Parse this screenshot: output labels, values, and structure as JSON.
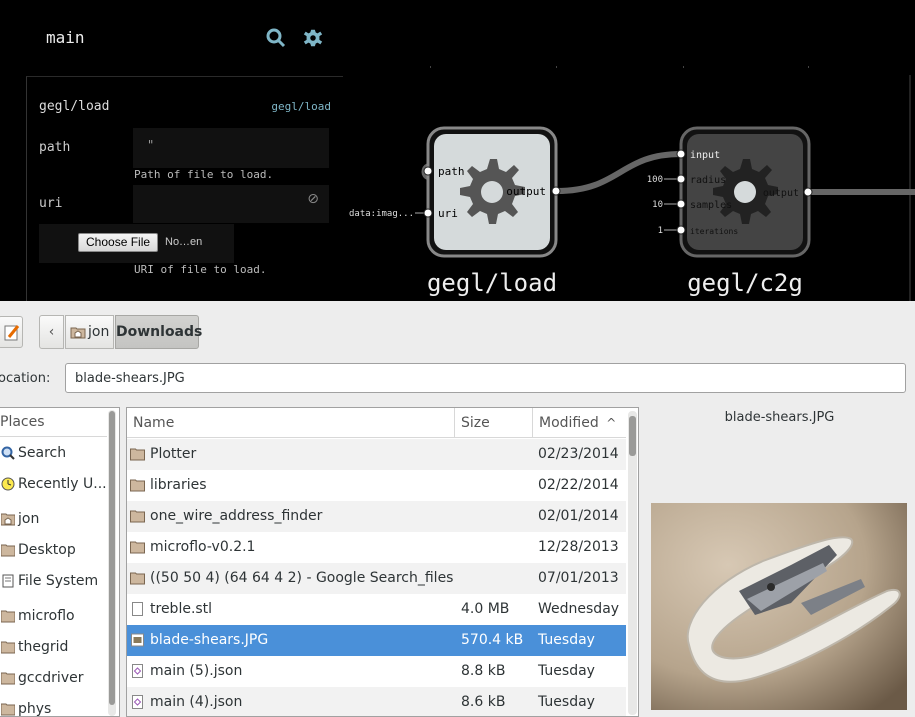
{
  "editor": {
    "graph_title": "main",
    "panel": {
      "title": "gegl/load",
      "link": "gegl/load",
      "path_label": "path",
      "path_value": "\"",
      "path_desc": "Path of file to load.",
      "uri_label": "uri",
      "uri_clear_icon": "⊘",
      "choose_file": "Choose File",
      "file_name": "No…en",
      "uri_desc": "URI of file to load."
    },
    "nodes": [
      {
        "title": "gegl/load",
        "inports": [
          "path",
          "uri"
        ],
        "outports": [
          "output"
        ],
        "inport_values": [
          "",
          "data:imag..."
        ]
      },
      {
        "title": "gegl/c2g",
        "inports": [
          "input",
          "radius",
          "samples",
          "iterations"
        ],
        "outports": [
          "output"
        ],
        "inport_values": [
          "",
          "100",
          "10",
          "1"
        ]
      }
    ],
    "accent_color": "#7fb6c7"
  },
  "chooser": {
    "breadcrumbs": [
      "jon",
      "Downloads"
    ],
    "location_label": "ocation:",
    "location_value": "blade-shears.JPG",
    "places_header": "Places",
    "places": [
      {
        "label": "Search",
        "icon": "search-icon"
      },
      {
        "label": "Recently U...",
        "icon": "recent-icon"
      },
      {
        "label": "jon",
        "icon": "home-folder-icon"
      },
      {
        "label": "Desktop",
        "icon": "folder-icon"
      },
      {
        "label": "File System",
        "icon": "drive-icon"
      },
      {
        "label": "microflo",
        "icon": "folder-icon"
      },
      {
        "label": "thegrid",
        "icon": "folder-icon"
      },
      {
        "label": "gccdriver",
        "icon": "folder-icon"
      },
      {
        "label": "phys",
        "icon": "folder-icon"
      }
    ],
    "columns": {
      "name": "Name",
      "size": "Size",
      "modified": "Modified"
    },
    "files": [
      {
        "name": "Plotter",
        "size": "",
        "modified": "02/23/2014",
        "icon": "folder-icon"
      },
      {
        "name": "libraries",
        "size": "",
        "modified": "02/22/2014",
        "icon": "folder-icon"
      },
      {
        "name": "one_wire_address_finder",
        "size": "",
        "modified": "02/01/2014",
        "icon": "folder-icon"
      },
      {
        "name": "microflo-v0.2.1",
        "size": "",
        "modified": "12/28/2013",
        "icon": "folder-icon"
      },
      {
        "name": "((50 50 4) (64 64 4 2) - Google Search_files",
        "size": "",
        "modified": "07/01/2013",
        "icon": "folder-icon"
      },
      {
        "name": "treble.stl",
        "size": "4.0 MB",
        "modified": "Wednesday",
        "icon": "file-icon"
      },
      {
        "name": "blade-shears.JPG",
        "size": "570.4 kB",
        "modified": "Tuesday",
        "icon": "image-file-icon"
      },
      {
        "name": "main (5).json",
        "size": "8.8 kB",
        "modified": "Tuesday",
        "icon": "json-file-icon"
      },
      {
        "name": "main (4).json",
        "size": "8.6 kB",
        "modified": "Tuesday",
        "icon": "json-file-icon"
      }
    ],
    "selected_index": 6,
    "preview_title": "blade-shears.JPG",
    "selection_color": "#4a90d9"
  }
}
